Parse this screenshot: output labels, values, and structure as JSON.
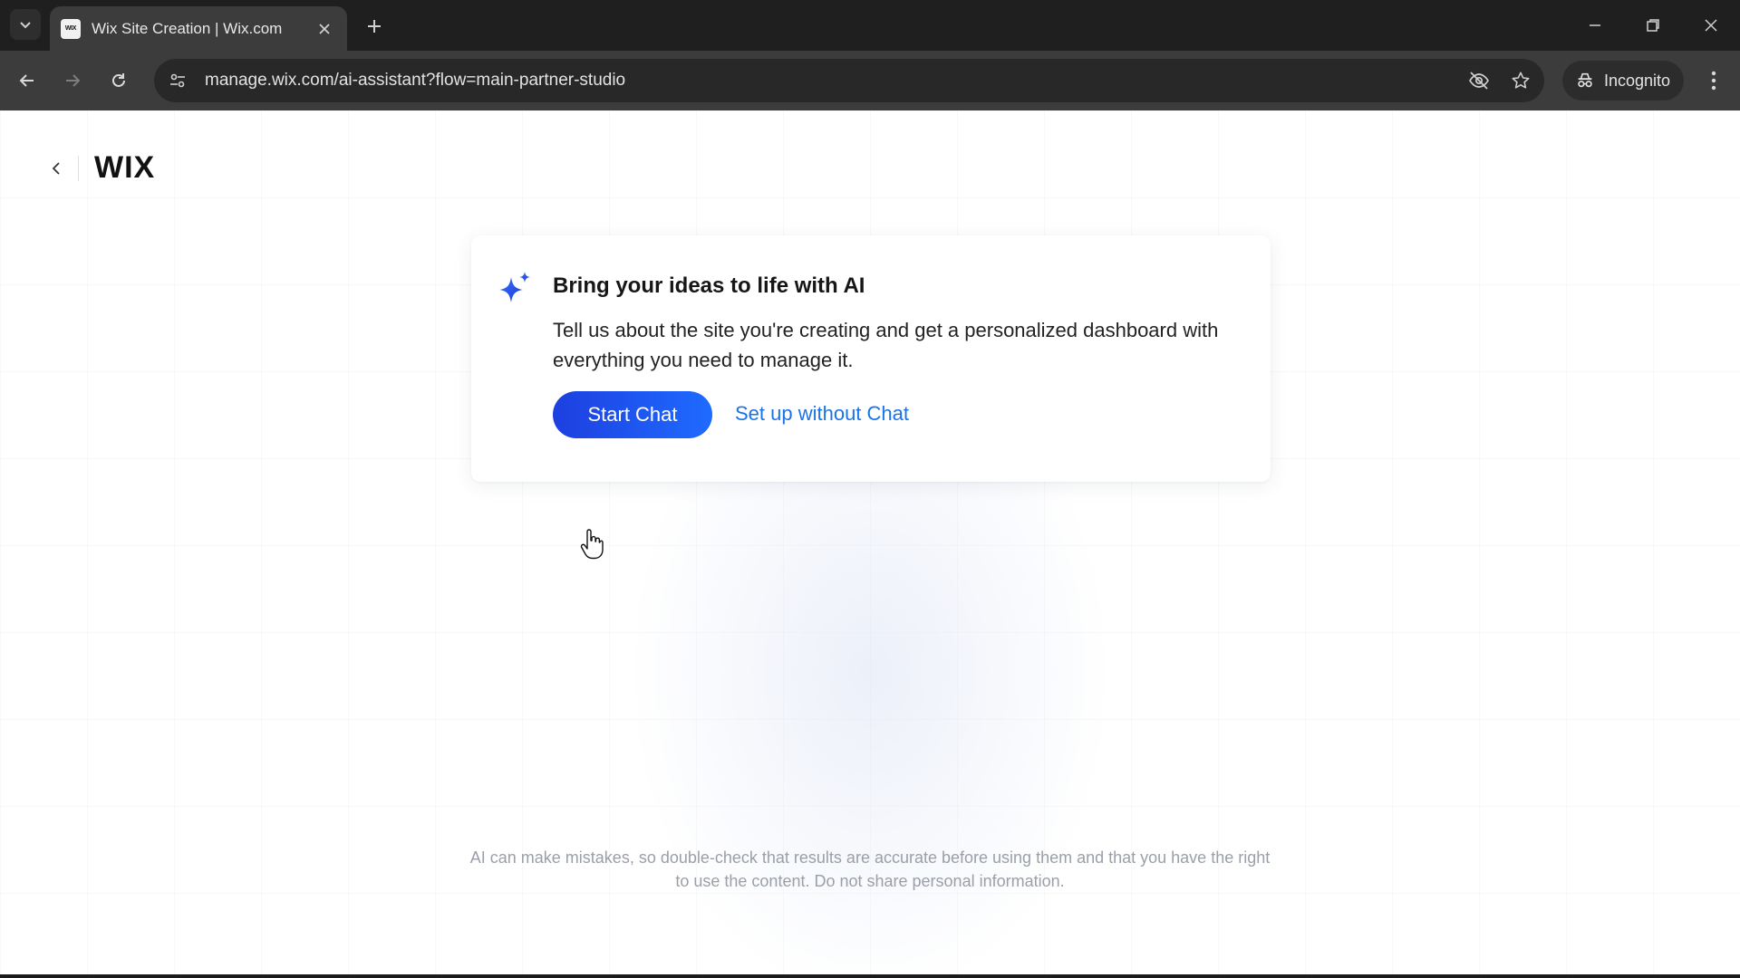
{
  "browser": {
    "tab": {
      "favicon_text": "WIX",
      "title": "Wix Site Creation | Wix.com"
    },
    "address_bar": {
      "url": "manage.wix.com/ai-assistant?flow=main-partner-studio"
    },
    "incognito_label": "Incognito",
    "icons": {
      "tab_search": "chevron-down-icon",
      "tab_close": "close-icon",
      "new_tab": "plus-icon",
      "minimize": "minimize-icon",
      "restore": "restore-icon",
      "close_window": "close-icon",
      "back": "arrow-left-icon",
      "forward": "arrow-right-icon",
      "reload": "reload-icon",
      "site_info": "tune-icon",
      "eye_off": "eye-off-icon",
      "bookmark": "star-icon",
      "incognito": "incognito-icon",
      "menu": "kebab-menu-icon"
    }
  },
  "page": {
    "logo": "WIX",
    "card": {
      "title": "Bring your ideas to life with AI",
      "description": "Tell us about the site you're creating and get a personalized dashboard with everything you need to manage it.",
      "primary_button": "Start Chat",
      "secondary_link": "Set up without Chat"
    },
    "disclaimer": "AI can make mistakes, so double-check that results are accurate before using them and that you have the right to use the content. Do not share personal information."
  },
  "colors": {
    "primary_blue": "#1d4ff0",
    "link_blue": "#1a73e8",
    "chrome_dark": "#1f1f1f",
    "chrome_toolbar": "#3c3c3c"
  }
}
